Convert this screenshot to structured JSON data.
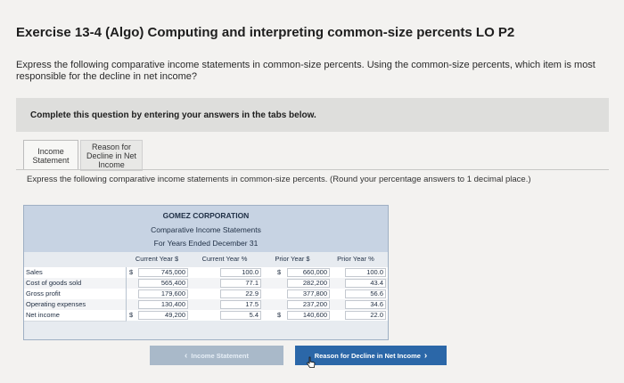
{
  "header": {
    "title": "Exercise 13-4 (Algo) Computing and interpreting common-size percents LO P2"
  },
  "instructions": "Express the following comparative income statements in common-size percents. Using the common-size percents, which item is most responsible for the decline in net income?",
  "banner": "Complete this question by entering your answers in the tabs below.",
  "tabs": [
    {
      "label_1": "Income",
      "label_2": "Statement"
    },
    {
      "label_1": "Reason for",
      "label_2": "Decline in Net",
      "label_3": "Income"
    }
  ],
  "panel_instructions": "Express the following comparative income statements in common-size percents. (Round your percentage answers to 1 decimal place.)",
  "table": {
    "company": "GOMEZ CORPORATION",
    "statement": "Comparative Income Statements",
    "period": "For Years Ended December 31",
    "columns": [
      "Current Year $",
      "Current Year %",
      "Prior Year $",
      "Prior Year %"
    ],
    "rows": [
      {
        "label": "Sales",
        "cur_sym": "$",
        "cy": "745,000",
        "cyp": "100.0",
        "prior_sym": "$",
        "py": "660,000",
        "pyp": "100.0"
      },
      {
        "label": "Cost of goods sold",
        "cur_sym": "",
        "cy": "565,400",
        "cyp": "77.1",
        "prior_sym": "",
        "py": "282,200",
        "pyp": "43.4"
      },
      {
        "label": "Gross profit",
        "cur_sym": "",
        "cy": "179,600",
        "cyp": "22.9",
        "prior_sym": "",
        "py": "377,800",
        "pyp": "56.6"
      },
      {
        "label": "Operating expenses",
        "cur_sym": "",
        "cy": "130,400",
        "cyp": "17.5",
        "prior_sym": "",
        "py": "237,200",
        "pyp": "34.6"
      },
      {
        "label": "Net income",
        "cur_sym": "$",
        "cy": "49,200",
        "cyp": "5.4",
        "prior_sym": "$",
        "py": "140,600",
        "pyp": "22.0"
      }
    ]
  },
  "navigation": {
    "prev": "Income Statement",
    "next": "Reason for Decline in Net Income",
    "next_icon": "chevron-right-icon"
  },
  "colors": {
    "table_header": "#c7d3e3",
    "next_button": "#2b67a8",
    "prev_button": "#a9b9c9"
  }
}
